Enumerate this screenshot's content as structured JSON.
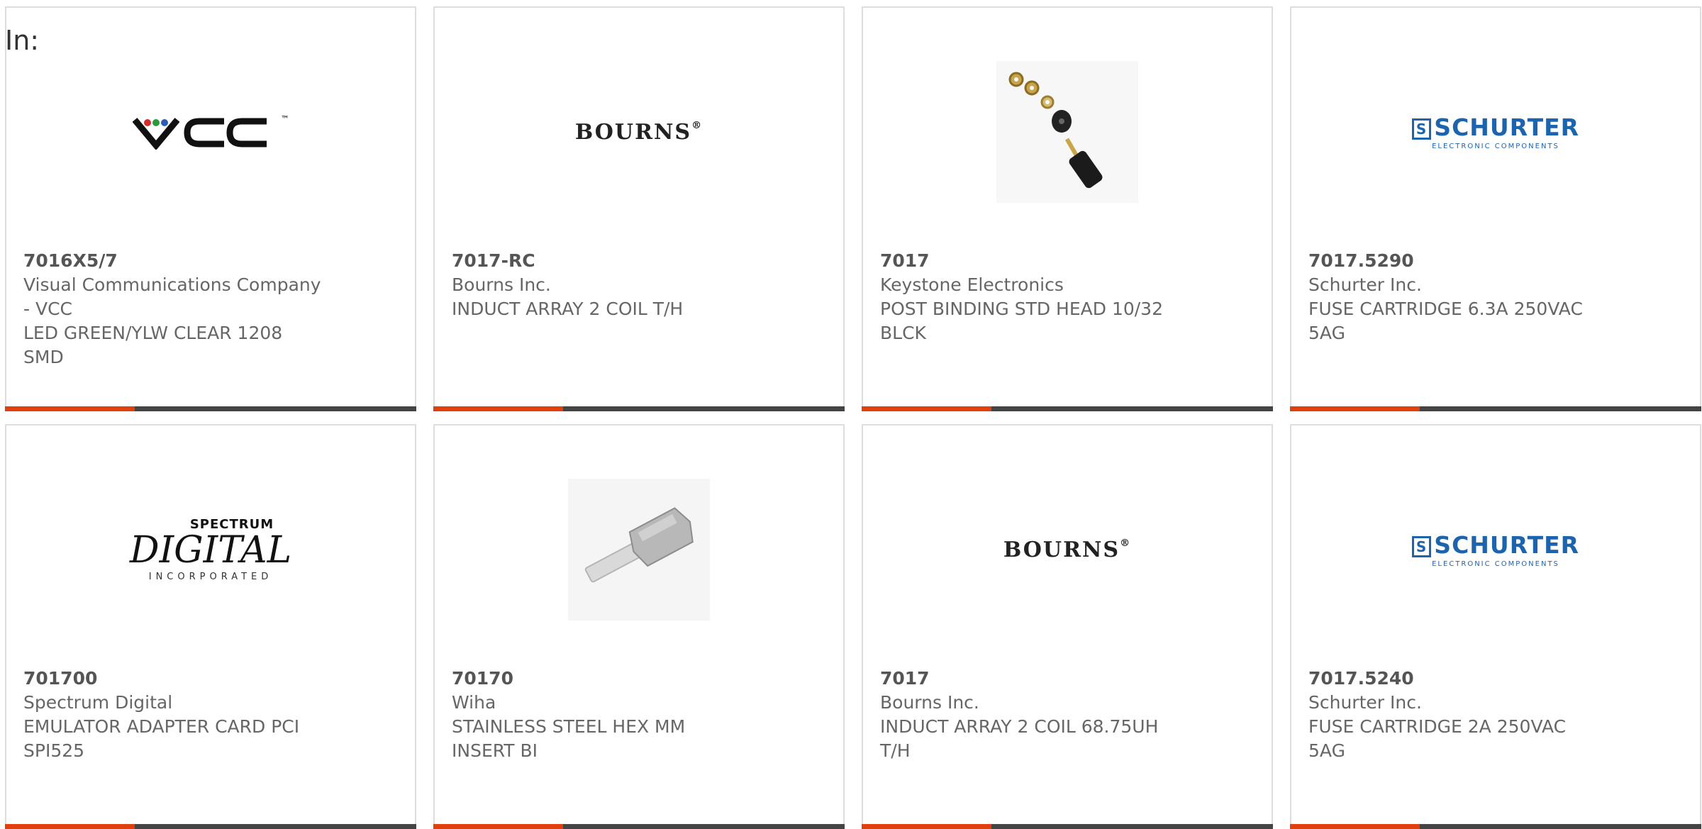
{
  "header": {
    "in_label": "In:"
  },
  "colors": {
    "accent": "#e0400e",
    "bar_dark": "#444444",
    "text": "#666666",
    "schurter_blue": "#1d64ae"
  },
  "products": [
    {
      "part_number": "7016X5/7",
      "manufacturer_lines": [
        "Visual Communications Company",
        "- VCC"
      ],
      "description_lines": [
        "LED GREEN/YLW CLEAR 1208",
        "SMD"
      ],
      "image": {
        "kind": "logo",
        "logo_text": "VCC",
        "trademark": "™"
      }
    },
    {
      "part_number": "7017-RC",
      "manufacturer_lines": [
        "Bourns Inc."
      ],
      "description_lines": [
        "INDUCT ARRAY 2 COIL T/H"
      ],
      "image": {
        "kind": "logo",
        "logo_text": "BOURNS",
        "trademark": "®"
      }
    },
    {
      "part_number": "7017",
      "manufacturer_lines": [
        "Keystone Electronics"
      ],
      "description_lines": [
        "POST BINDING STD HEAD 10/32",
        "BLCK"
      ],
      "image": {
        "kind": "photo",
        "depicts": "binding-post"
      }
    },
    {
      "part_number": "7017.5290",
      "manufacturer_lines": [
        "Schurter Inc."
      ],
      "description_lines": [
        "FUSE CARTRIDGE 6.3A 250VAC",
        "5AG"
      ],
      "image": {
        "kind": "logo",
        "logo_text": "SCHURTER",
        "logo_subtext": "ELECTRONIC COMPONENTS"
      }
    },
    {
      "part_number": "701700",
      "manufacturer_lines": [
        "Spectrum Digital"
      ],
      "description_lines": [
        "EMULATOR ADAPTER CARD PCI",
        "SPI525"
      ],
      "image": {
        "kind": "logo",
        "logo_top": "SPECTRUM",
        "logo_text": "DIGITAL",
        "logo_subtext": "INCORPORATED"
      }
    },
    {
      "part_number": "70170",
      "manufacturer_lines": [
        "Wiha"
      ],
      "description_lines": [
        "STAINLESS STEEL HEX MM",
        "INSERT BI"
      ],
      "image": {
        "kind": "photo",
        "depicts": "hex-bit"
      }
    },
    {
      "part_number": "7017",
      "manufacturer_lines": [
        "Bourns Inc."
      ],
      "description_lines": [
        "INDUCT ARRAY 2 COIL 68.75UH",
        "T/H"
      ],
      "image": {
        "kind": "logo",
        "logo_text": "BOURNS",
        "trademark": "®"
      }
    },
    {
      "part_number": "7017.5240",
      "manufacturer_lines": [
        "Schurter Inc."
      ],
      "description_lines": [
        "FUSE CARTRIDGE 2A 250VAC",
        "5AG"
      ],
      "image": {
        "kind": "logo",
        "logo_text": "SCHURTER",
        "logo_subtext": "ELECTRONIC COMPONENTS"
      }
    }
  ]
}
